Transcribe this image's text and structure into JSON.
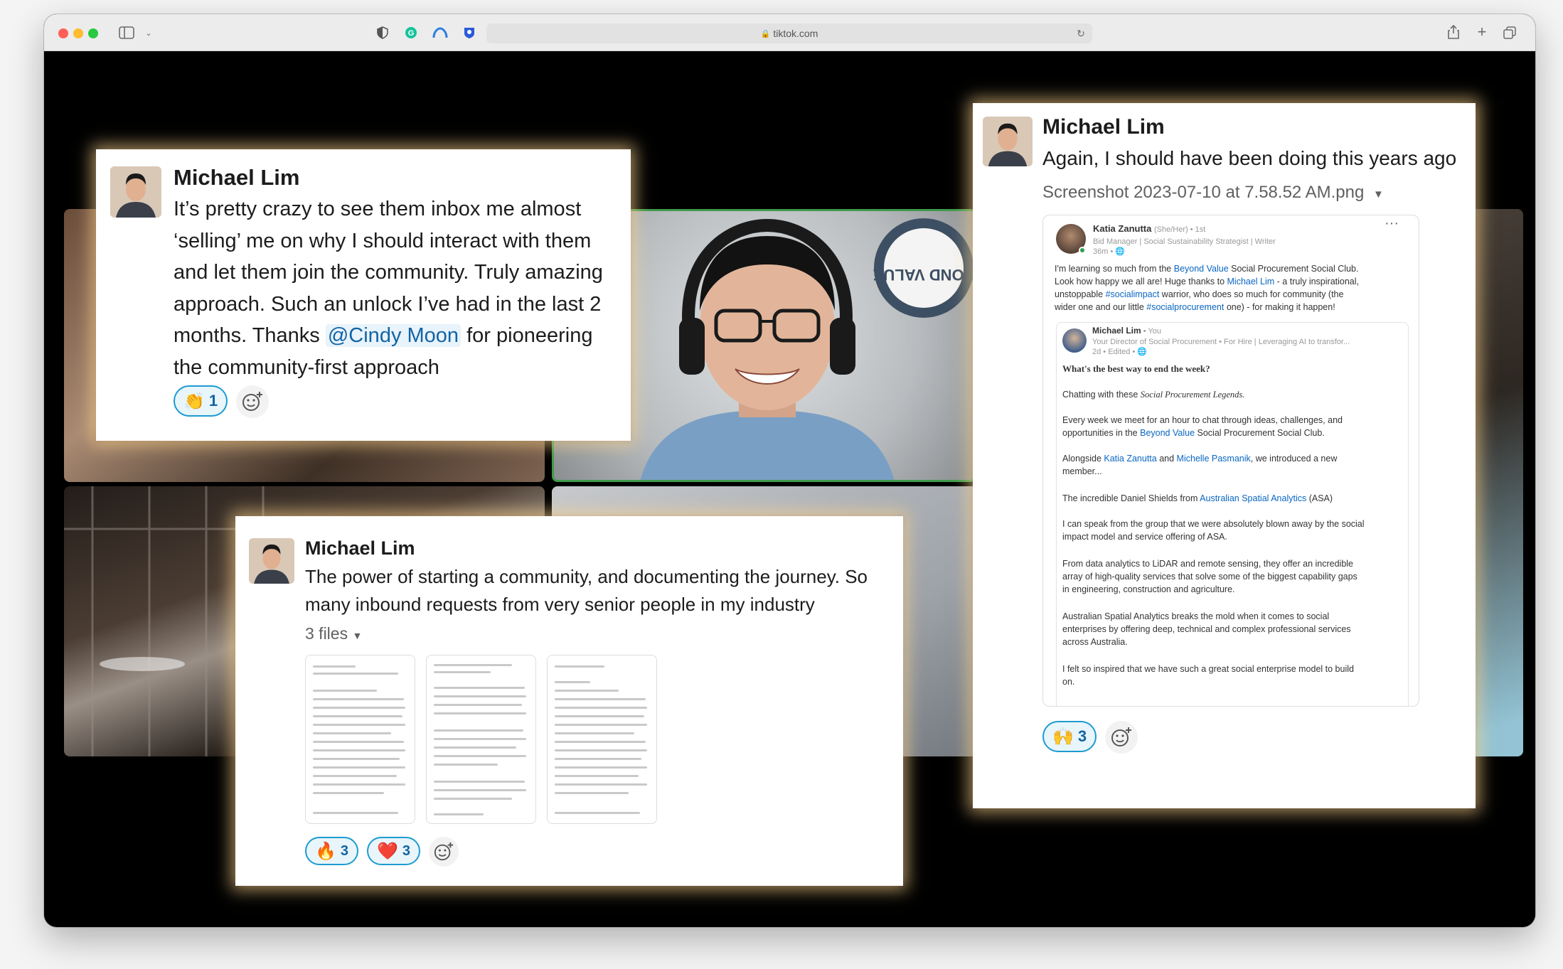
{
  "browser": {
    "url": "tiktok.com"
  },
  "card1": {
    "name": "Michael Lim",
    "text_before": "It’s pretty crazy to see them inbox me almost ‘selling’ me on why I should interact with them and let them join the community. Truly amazing approach. Such an unlock I’ve had in the last 2 months. Thanks ",
    "mention": "@Cindy Moon",
    "text_after": " for pioneering the community-first approach",
    "reactions": [
      {
        "emoji": "👏",
        "count": "1"
      }
    ]
  },
  "card2": {
    "name": "Michael Lim",
    "text": "The power of starting a community, and documenting the journey. So many inbound requests from very senior people in my industry",
    "files_label": "3 files",
    "reactions": [
      {
        "emoji": "🔥",
        "count": "3"
      },
      {
        "emoji": "❤️",
        "count": "3"
      }
    ]
  },
  "card3": {
    "name": "Michael Lim",
    "text": "Again, I should have been doing this years ago",
    "file_name": "Screenshot 2023-07-10 at 7.58.52 AM.png",
    "reactions": [
      {
        "emoji": "🙌",
        "count": "3"
      }
    ],
    "post": {
      "author": "Katia Zanutta",
      "author_meta": "(She/Her) • 1st",
      "author_title": "Bid Manager | Social Sustainability Strategist | Writer",
      "author_time": "36m • 🌐",
      "p1_a": "I'm learning so much from the ",
      "p1_link": "Beyond Value",
      "p1_b": " Social Procurement Social Club.",
      "p2_a": "Look how happy we all are! Huge thanks to ",
      "p2_link": "Michael Lim",
      "p2_b": " - a truly inspirational,",
      "p3_a": "unstoppable ",
      "p3_link": "#socialimpact",
      "p3_b": " warrior, who does so much for community (the",
      "p4_a": "wider one and our little ",
      "p4_link": "#socialprocurement",
      "p4_b": " one) - for making it happen!",
      "inner_author": "Michael Lim",
      "inner_author_meta": " • You",
      "inner_title": "Your Director of Social Procurement • For Hire | Leveraging AI to transfor...",
      "inner_time": "2d • Edited • 🌐",
      "inner_heading": "What's the best way to end the week?",
      "i1_a": "Chatting with these ",
      "i1_em": "Social Procurement Legends.",
      "i2": "Every week we meet for an hour to chat through ideas, challenges, and",
      "i3_a": "opportunities in the ",
      "i3_link": "Beyond Value",
      "i3_b": " Social Procurement Social Club.",
      "i4_a": "Alongside ",
      "i4_link1": "Katia Zanutta",
      "i4_mid": " and ",
      "i4_link2": "Michelle Pasmanik",
      "i4_b": ", we introduced a new",
      "i5": "member...",
      "i6_a": "The incredible Daniel Shields from ",
      "i6_link": "Australian Spatial Analytics",
      "i6_b": " (ASA)",
      "i7": "I can speak from the group that we were absolutely blown away by the social",
      "i8": "impact model and service offering of ASA.",
      "i9": "From data analytics to LiDAR and remote sensing, they offer an incredible",
      "i10": "array of high-quality services that solve some of the biggest capability gaps",
      "i11": "in engineering, construction and agriculture.",
      "i12": "Australian Spatial Analytics breaks the mold when it comes to social",
      "i13": "enterprises by offering deep, technical and complex professional services",
      "i14": "across Australia.",
      "i15": "I felt so inspired that we have such a great social enterprise model to build",
      "i16": "on."
    }
  },
  "badge_text": "YOND VALUE",
  "colors": {
    "accent": "#1264a3",
    "reaction_border": "#1d9bd1",
    "glow": "#ffd48c",
    "speaker_border": "#3f9a4a"
  }
}
